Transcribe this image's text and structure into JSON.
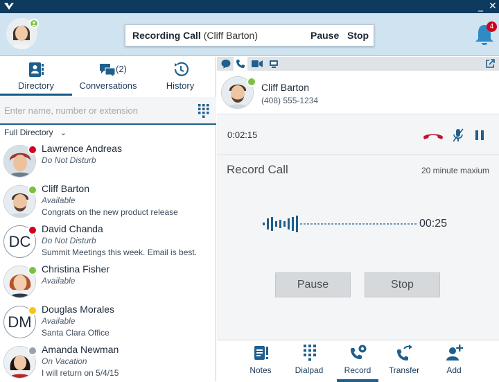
{
  "titlebar": {
    "minimize": "_",
    "close": "✕"
  },
  "recording": {
    "title": "Recording Call",
    "who": "(Cliff Barton)",
    "pause": "Pause",
    "stop": "Stop"
  },
  "notifications": {
    "count": "4"
  },
  "tabs": [
    {
      "label": "Directory",
      "active": true
    },
    {
      "label": "Conversations",
      "count": "(2)"
    },
    {
      "label": "History"
    }
  ],
  "search": {
    "placeholder": "Enter name, number or extension",
    "value": ""
  },
  "filter": {
    "label": "Full Directory"
  },
  "contacts": [
    {
      "name": "Lawrence Andreas",
      "status": "Do Not Disturb",
      "note": "",
      "status_color": "#d0021b"
    },
    {
      "name": "Cliff Barton",
      "status": "Available",
      "note": "Congrats on the new product release",
      "status_color": "#7ac142"
    },
    {
      "name": "David Chanda",
      "initials": "DC",
      "status": "Do Not Disturb",
      "note": "Summit Meetings this week. Email is best.",
      "status_color": "#d0021b"
    },
    {
      "name": "Christina Fisher",
      "status": "Available",
      "note": "",
      "status_color": "#7ac142"
    },
    {
      "name": "Douglas Morales",
      "initials": "DM",
      "status": "Available",
      "note": "Santa Clara Office",
      "status_color": "#f5c518"
    },
    {
      "name": "Amanda Newman",
      "status": "On Vacation",
      "note": "I will return on 5/4/15",
      "status_color": "#9aa3ab"
    }
  ],
  "call": {
    "name": "Cliff Barton",
    "number": "(408) 555-1234",
    "timer": "0:02:15"
  },
  "record": {
    "title": "Record Call",
    "max": "20 minute maxium",
    "elapsed": "00:25",
    "pause": "Pause",
    "stop": "Stop"
  },
  "bottom_tabs": [
    {
      "label": "Notes"
    },
    {
      "label": "Dialpad"
    },
    {
      "label": "Record",
      "active": true
    },
    {
      "label": "Transfer"
    },
    {
      "label": "Add"
    }
  ],
  "colors": {
    "accent": "#1f5f8e",
    "titlebar": "#0e3a60",
    "header": "#cfe3f1",
    "dnd": "#d0021b",
    "available": "#7ac142",
    "hangup": "#c0152f"
  }
}
